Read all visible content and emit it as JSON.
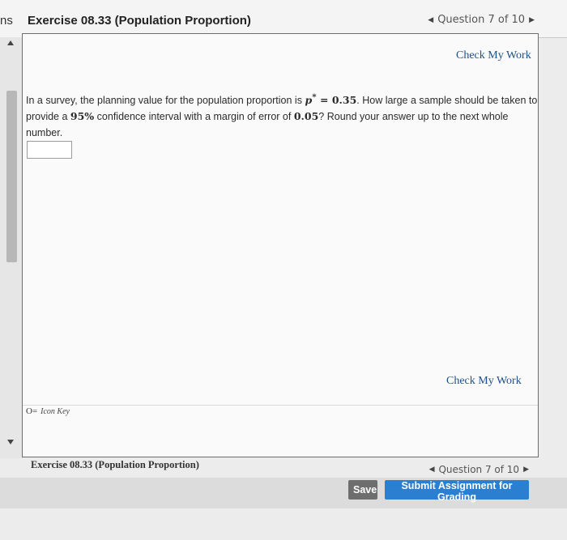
{
  "header": {
    "nav_cutoff": "ns",
    "exercise_title": "Exercise 08.33 (Population Proportion)",
    "question_nav": "Question 7 of 10"
  },
  "panel": {
    "check_my_work_top": "Check My Work",
    "check_my_work_bottom": "Check My Work",
    "question": {
      "t1": "In a survey, the planning value for the population proportion is ",
      "p_symbol": "p",
      "p_star": "*",
      "equals_value": " = 0.35",
      "t2": ". How large a sample should be taken to provide a ",
      "confidence": "95%",
      "t3": " confidence interval with a margin of error of ",
      "margin": "0.05",
      "t4": "? Round your answer up to the next whole number."
    },
    "answer_value": "",
    "icon_key_glyph": "O=",
    "icon_key_label": "Icon Key"
  },
  "footer": {
    "exercise_title": "Exercise 08.33 (Population Proportion)",
    "question_nav": "Question 7 of 10",
    "save_label": "Save",
    "submit_label": "Submit Assignment for Grading"
  },
  "colors": {
    "link": "#1e4f8a",
    "submit_button": "#2b7fd0",
    "save_button": "#6e6e6e"
  }
}
